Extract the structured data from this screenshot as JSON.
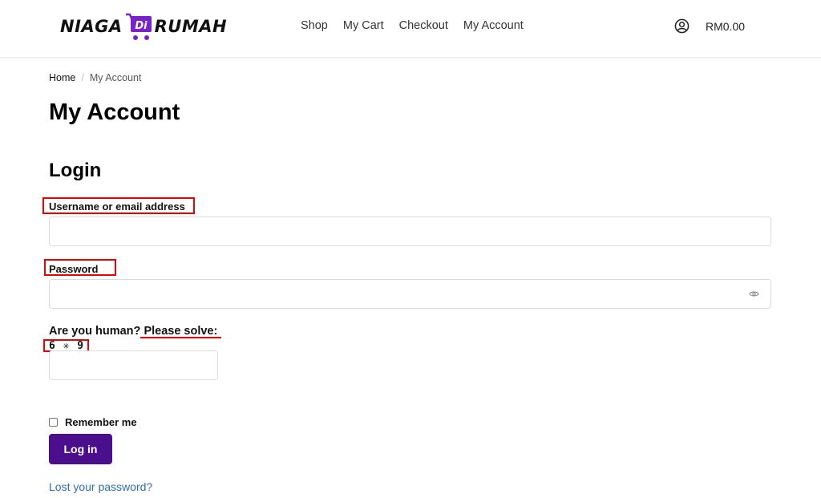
{
  "header": {
    "logo": {
      "left_text": "NIAGA",
      "badge_text": "Di",
      "right_text": "RUMAH",
      "brand_color": "#7a22c9"
    },
    "nav": [
      "Shop",
      "My Cart",
      "Checkout",
      "My Account"
    ],
    "account_icon": "user-circle-icon",
    "cart_total": "RM0.00"
  },
  "breadcrumb": {
    "home": "Home",
    "separator": "/",
    "current": "My Account"
  },
  "page_title": "My Account",
  "login": {
    "title": "Login",
    "username_label": "Username or email address",
    "username_value": "",
    "password_label": "Password",
    "password_value": "",
    "password_toggle_icon": "eye-icon",
    "human_question": "Are you human?",
    "human_prompt": "Please solve:",
    "captcha_text": "6 ✳ 9",
    "captcha_value": "",
    "remember_label": "Remember me",
    "remember_checked": false,
    "submit_label": "Log in",
    "lost_password": "Lost your password?"
  },
  "colors": {
    "button_bg": "#4b0e8c",
    "link": "#2f6db3",
    "annotation": "#e00000"
  }
}
